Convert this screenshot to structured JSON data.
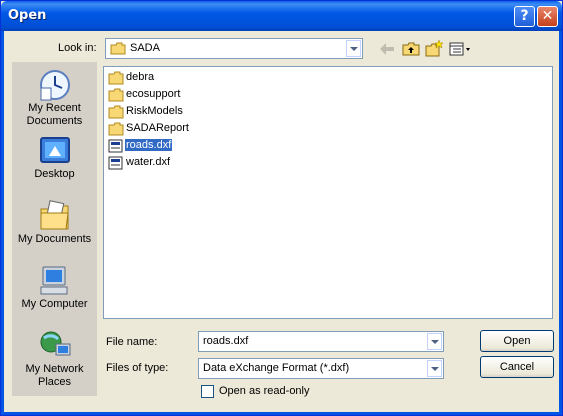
{
  "window": {
    "title": "Open",
    "help_glyph": "?",
    "close_glyph": "✕"
  },
  "look_in": {
    "label": "Look in:",
    "value": "SADA",
    "icon": "folder-icon"
  },
  "toolbar": {
    "back": "back-arrow-icon",
    "up": "up-folder-icon",
    "new_folder": "new-folder-icon",
    "views": "views-menu-icon"
  },
  "places": [
    {
      "label": "My Recent Documents",
      "icon": "recent-documents-icon"
    },
    {
      "label": "Desktop",
      "icon": "desktop-icon"
    },
    {
      "label": "My Documents",
      "icon": "my-documents-icon"
    },
    {
      "label": "My Computer",
      "icon": "my-computer-icon"
    },
    {
      "label": "My Network Places",
      "icon": "network-places-icon"
    }
  ],
  "files": [
    {
      "name": "debra",
      "type": "folder",
      "selected": false
    },
    {
      "name": "ecosupport",
      "type": "folder",
      "selected": false
    },
    {
      "name": "RiskModels",
      "type": "folder",
      "selected": false
    },
    {
      "name": "SADAReport",
      "type": "folder",
      "selected": false
    },
    {
      "name": "roads.dxf",
      "type": "dxf",
      "selected": true
    },
    {
      "name": "water.dxf",
      "type": "dxf",
      "selected": false
    }
  ],
  "file_name": {
    "label": "File name:",
    "value": "roads.dxf"
  },
  "file_type": {
    "label": "Files of type:",
    "value": "Data eXchange Format (*.dxf)"
  },
  "readonly": {
    "label": "Open as read-only",
    "checked": false
  },
  "buttons": {
    "open": "Open",
    "cancel": "Cancel"
  },
  "colors": {
    "title_bar": "#0055e5",
    "selection": "#316ac5",
    "dialog_bg": "#ece9d8"
  }
}
